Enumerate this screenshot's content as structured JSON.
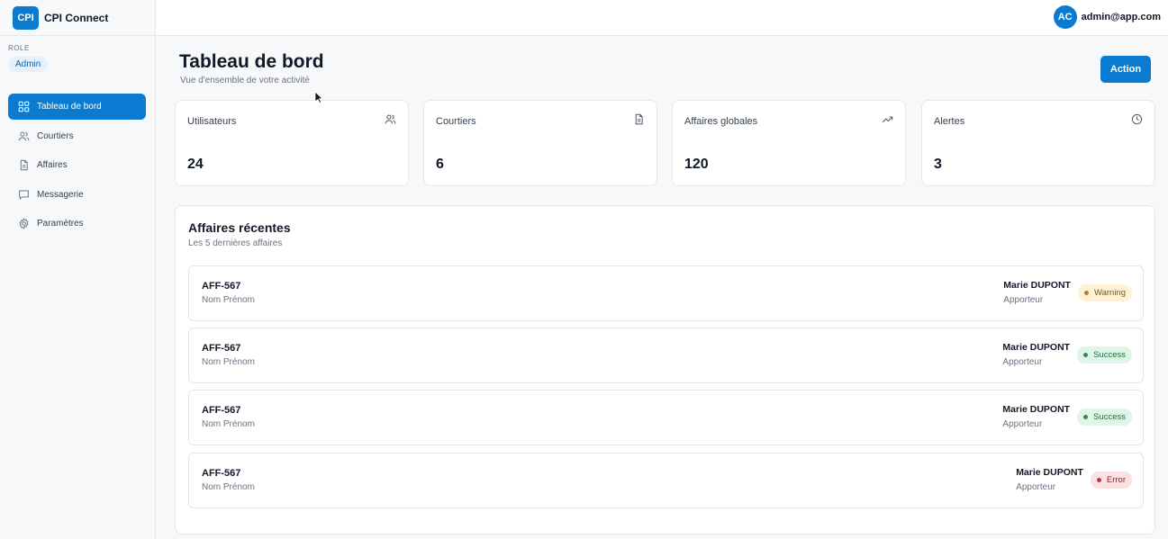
{
  "brand": {
    "logo": "CPI",
    "name": "CPI Connect"
  },
  "role": {
    "label": "ROLE",
    "value": "Admin"
  },
  "nav": [
    {
      "label": "Tableau de bord",
      "icon": "grid-icon",
      "active": true
    },
    {
      "label": "Courtiers",
      "icon": "users-icon",
      "active": false
    },
    {
      "label": "Affaires",
      "icon": "file-icon",
      "active": false
    },
    {
      "label": "Messagerie",
      "icon": "message-icon",
      "active": false
    },
    {
      "label": "Paramètres",
      "icon": "gear-icon",
      "active": false
    }
  ],
  "user": {
    "initials": "AC",
    "email": "admin@app.com"
  },
  "header": {
    "title": "Tableau de bord",
    "subtitle": "Vue d'ensemble de votre activité",
    "action_label": "Action"
  },
  "stats": [
    {
      "label": "Utilisateurs",
      "value": "24",
      "icon": "users-icon"
    },
    {
      "label": "Courtiers",
      "value": "6",
      "icon": "file-icon"
    },
    {
      "label": "Affaires globales",
      "value": "120",
      "icon": "trending-up-icon"
    },
    {
      "label": "Alertes",
      "value": "3",
      "icon": "clock-icon"
    }
  ],
  "recent": {
    "title": "Affaires récentes",
    "subtitle": "Les 5 dernières affaires",
    "rows": [
      {
        "code": "AFF-567",
        "name": "Nom Prénom",
        "person": "Marie DUPONT",
        "person_role": "Apporteur",
        "status": "Warning",
        "status_type": "warning"
      },
      {
        "code": "AFF-567",
        "name": "Nom Prénom",
        "person": "Marie DUPONT",
        "person_role": "Apporteur",
        "status": "Success",
        "status_type": "success"
      },
      {
        "code": "AFF-567",
        "name": "Nom Prénom",
        "person": "Marie DUPONT",
        "person_role": "Apporteur",
        "status": "Success",
        "status_type": "success"
      },
      {
        "code": "AFF-567",
        "name": "Nom Prénom",
        "person": "Marie DUPONT",
        "person_role": "Apporteur",
        "status": "Error",
        "status_type": "error"
      }
    ]
  },
  "colors": {
    "primary": "#0a7bd0",
    "warning": "#fdf1d6",
    "success": "#dff5e7",
    "error": "#fbe1e1"
  }
}
